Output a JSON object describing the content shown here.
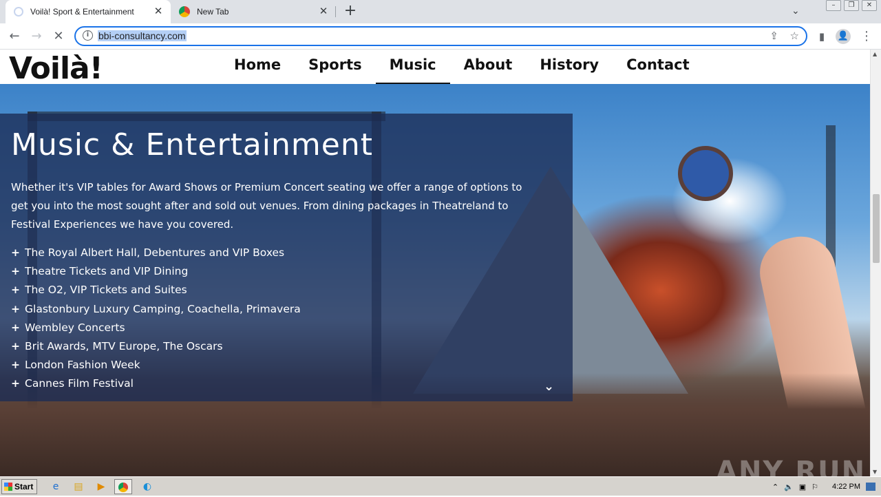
{
  "browser": {
    "tabs": [
      {
        "title": "Voilà! Sport & Entertainment",
        "active": true,
        "loading": true
      },
      {
        "title": "New Tab",
        "active": false
      }
    ],
    "url": "bbi-consultancy.com"
  },
  "site": {
    "logo": "Voilà!",
    "nav": [
      "Home",
      "Sports",
      "Music",
      "About",
      "History",
      "Contact"
    ],
    "active_nav": "Music"
  },
  "hero": {
    "title": "Music & Entertainment",
    "intro": "Whether it's VIP tables for Award Shows or Premium Concert seating we offer a range of options to get you into the most sought after and sold out venues. From dining packages in Theatreland to Festival Experiences we have you covered.",
    "items": [
      "The Royal Albert Hall, Debentures and VIP Boxes",
      "Theatre Tickets and VIP Dining",
      "The O2, VIP Tickets and Suites",
      "Glastonbury Luxury Camping, Coachella, Primavera",
      "Wembley Concerts",
      "Brit Awards, MTV Europe, The Oscars",
      "London Fashion Week",
      "Cannes Film Festival"
    ],
    "watermark": "ANY RUN"
  },
  "taskbar": {
    "start_label": "Start",
    "clock": "4:22 PM"
  }
}
